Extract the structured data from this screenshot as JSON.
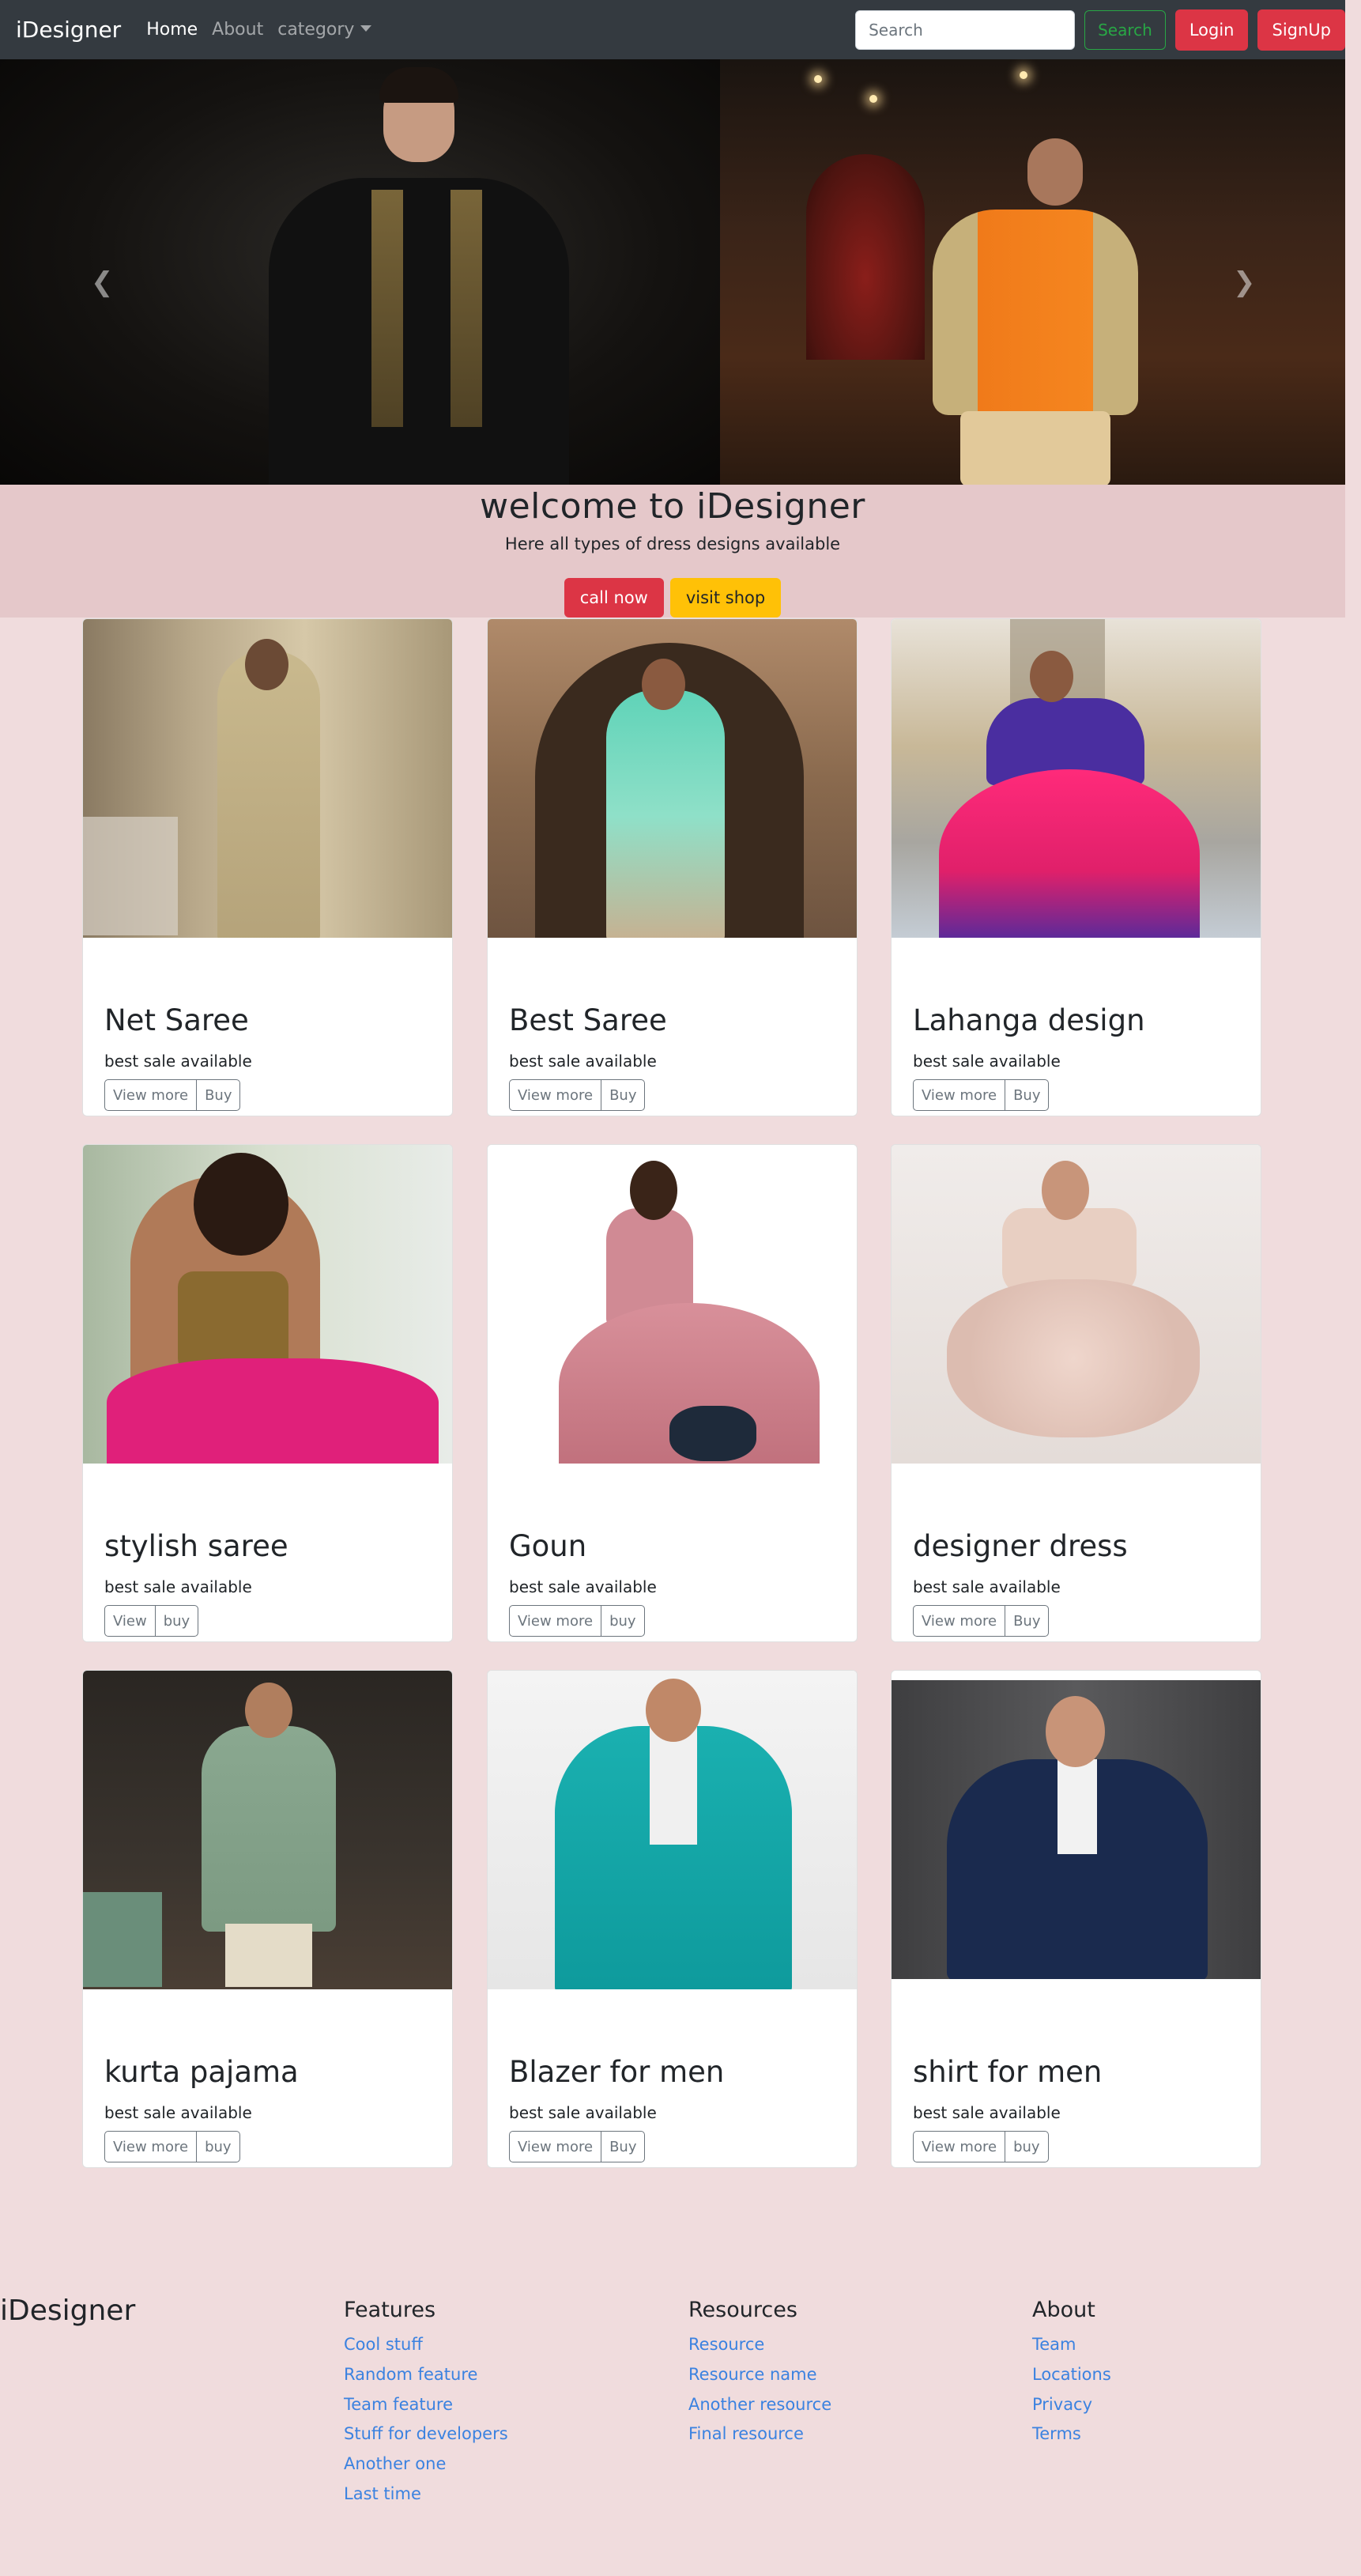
{
  "navbar": {
    "brand": "iDesigner",
    "links": [
      "Home",
      "About",
      "category"
    ],
    "search_placeholder": "Search",
    "search_button": "Search",
    "login": "Login",
    "signup": "SignUp"
  },
  "carousel": {
    "prev_icon": "chevron-left-icon",
    "next_icon": "chevron-right-icon"
  },
  "jumbotron": {
    "title": "welcome to iDesigner",
    "subtitle": "Here all types of dress designs available",
    "call_button": "call now",
    "shop_button": "visit shop"
  },
  "cards": [
    {
      "title": "Net Saree",
      "text": "best sale available",
      "btn1": "View more",
      "btn2": "Buy"
    },
    {
      "title": "Best Saree",
      "text": "best sale available",
      "btn1": "View more",
      "btn2": "Buy"
    },
    {
      "title": "Lahanga design",
      "text": "best sale available",
      "btn1": "View more",
      "btn2": "Buy"
    },
    {
      "title": "stylish saree",
      "text": "best sale available",
      "btn1": "View",
      "btn2": "buy"
    },
    {
      "title": "Goun",
      "text": "best sale available",
      "btn1": "View more",
      "btn2": "buy"
    },
    {
      "title": "designer dress",
      "text": "best sale available",
      "btn1": "View more",
      "btn2": "Buy"
    },
    {
      "title": "kurta pajama",
      "text": "best sale available",
      "btn1": "View more",
      "btn2": "buy"
    },
    {
      "title": "Blazer for men",
      "text": "best sale available",
      "btn1": "View more",
      "btn2": "Buy"
    },
    {
      "title": "shirt for men",
      "text": "best sale available",
      "btn1": "View more",
      "btn2": "buy"
    }
  ],
  "footer": {
    "brand": "iDesigner",
    "features": {
      "heading": "Features",
      "links": [
        "Cool stuff",
        "Random feature",
        "Team feature",
        "Stuff for developers",
        "Another one",
        "Last time"
      ]
    },
    "resources": {
      "heading": "Resources",
      "links": [
        "Resource",
        "Resource name",
        "Another resource",
        "Final resource"
      ]
    },
    "about": {
      "heading": "About",
      "links": [
        "Team",
        "Locations",
        "Privacy",
        "Terms"
      ]
    }
  },
  "colors": {
    "page_bg": "#f0dcdd",
    "navbar_bg": "#343a40",
    "jumbotron_bg": "#e5c8ca",
    "danger": "#dc3545",
    "warning": "#ffc107",
    "success": "#28a745",
    "link": "#3b82e0"
  }
}
